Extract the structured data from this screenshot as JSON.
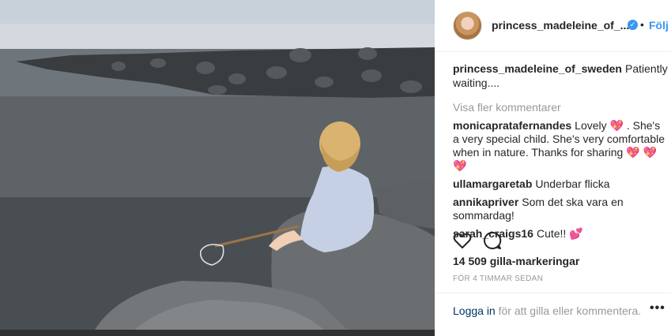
{
  "post": {
    "photo_alt": "",
    "header": {
      "username": "princess_madeleine_of_...",
      "verified_mark": "✓",
      "dot": "•",
      "follow_label": "Följ"
    },
    "caption": {
      "username": "princess_madeleine_of_sweden",
      "text": "Patiently waiting...."
    },
    "view_more_comments": "Visa fler kommentarer",
    "comments": [
      {
        "username": "monicapratafernandes",
        "text": "Lovely 💖 . She's a very special child. She's very comfortable when in nature. Thanks for sharing 💖 💖 💖"
      },
      {
        "username": "ullamargaretab",
        "text": "Underbar flicka"
      },
      {
        "username": "annikapriver",
        "text": "Som det ska vara en sommardag!"
      },
      {
        "username": "sarah_craigs16",
        "text": "Cute!! 💕"
      }
    ],
    "actions": {
      "like_icon": "heart-icon",
      "comment_icon": "comment-icon"
    },
    "likes": "14 509 gilla-markeringar",
    "timestamp": "FÖR 4 TIMMAR SEDAN",
    "footer": {
      "login_link": "Logga in",
      "login_text": " för att gilla eller kommentera.",
      "more_options": "•••"
    }
  },
  "colors": {
    "link_blue": "#3897f0",
    "text": "#262626",
    "muted": "#999999",
    "login_link": "#003569"
  }
}
